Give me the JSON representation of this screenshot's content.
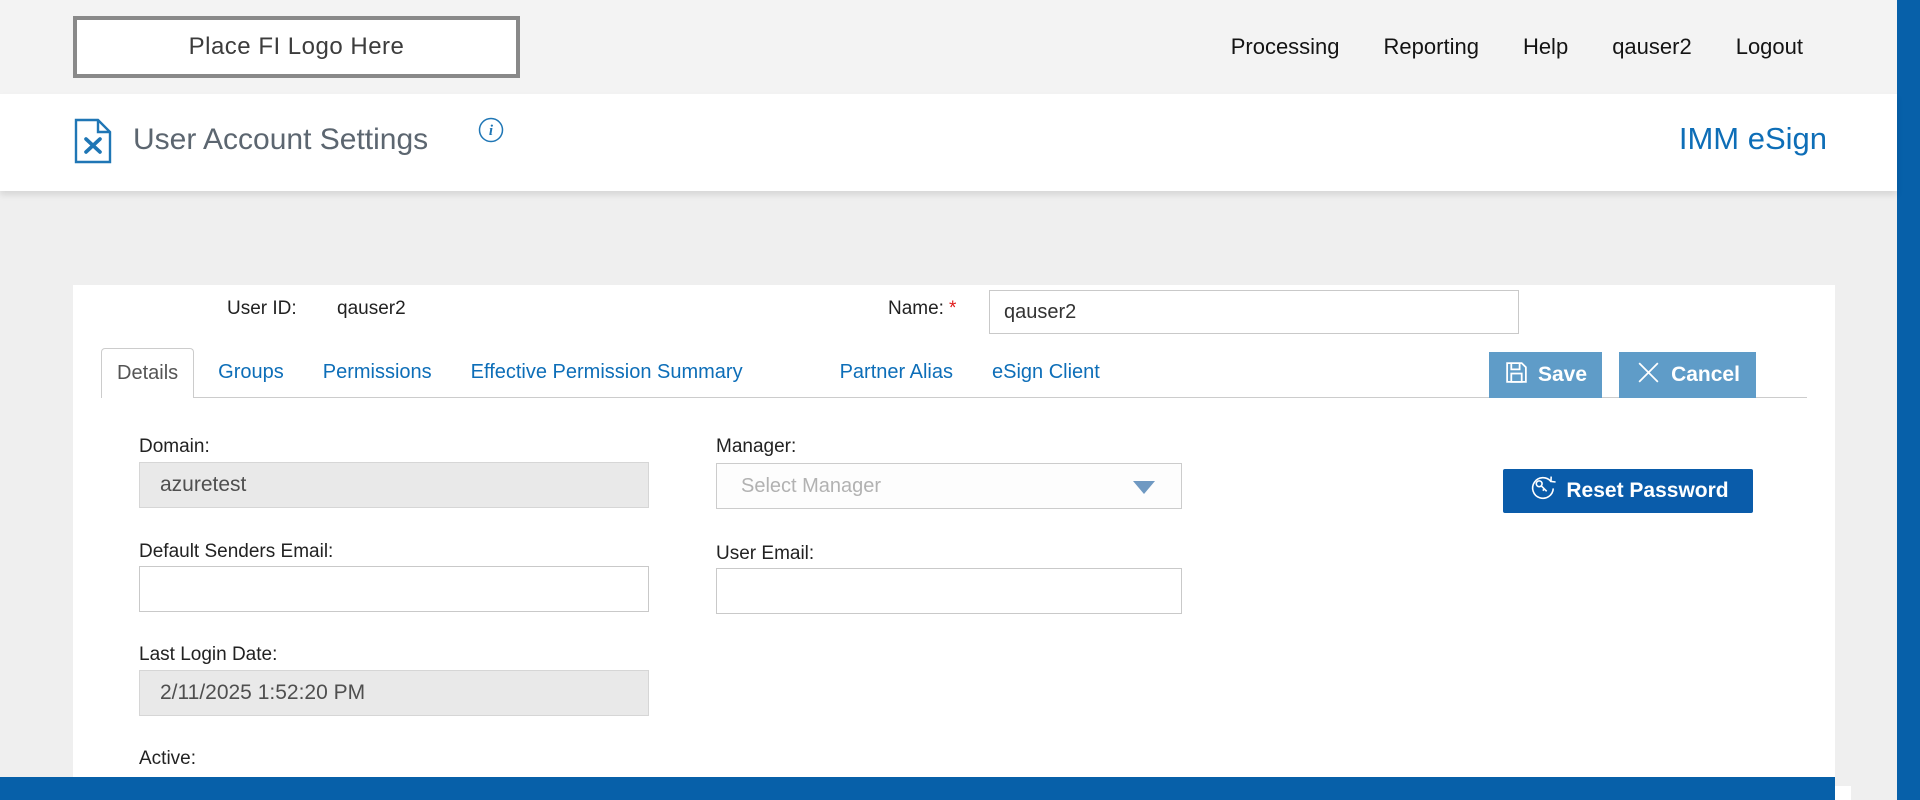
{
  "topbar": {
    "logo_text": "Place FI Logo Here",
    "nav": [
      {
        "label": "Processing"
      },
      {
        "label": "Reporting"
      },
      {
        "label": "Help"
      },
      {
        "label": "qauser2"
      },
      {
        "label": "Logout"
      }
    ]
  },
  "header": {
    "title": "User Account Settings",
    "brand": "IMM eSign"
  },
  "account": {
    "user_id_label": "User ID:",
    "user_id_value": "qauser2",
    "name_label": "Name:",
    "required_marker": "*",
    "name_value": "qauser2"
  },
  "tabs": [
    {
      "label": "Details"
    },
    {
      "label": "Groups"
    },
    {
      "label": "Permissions"
    },
    {
      "label": "Effective Permission Summary"
    },
    {
      "label": "Partner Alias"
    },
    {
      "label": "eSign Client"
    }
  ],
  "actions": {
    "save_label": "Save",
    "cancel_label": "Cancel",
    "reset_password_label": "Reset Password"
  },
  "form": {
    "domain": {
      "label": "Domain:",
      "value": "azuretest"
    },
    "manager": {
      "label": "Manager:",
      "placeholder": "Select Manager"
    },
    "default_senders_email": {
      "label": "Default Senders Email:",
      "value": ""
    },
    "user_email": {
      "label": "User Email:",
      "value": ""
    },
    "last_login": {
      "label": "Last Login Date:",
      "value": "2/11/2025 1:52:20 PM"
    },
    "active": {
      "label": "Active:"
    }
  },
  "colors": {
    "brand_blue": "#0e6eb7",
    "action_blue": "#5f9cc8",
    "primary_blue": "#0a5caa",
    "footer_blue": "#0760a9"
  }
}
